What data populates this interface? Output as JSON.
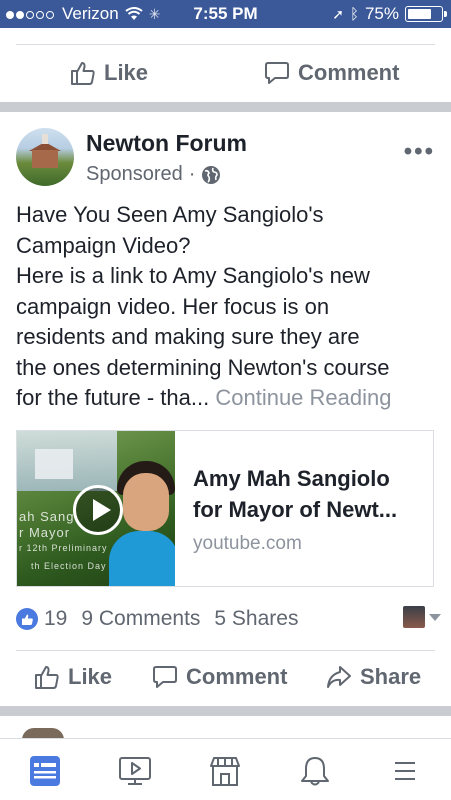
{
  "status_bar": {
    "carrier": "Verizon",
    "time": "7:55 PM",
    "battery": "75%",
    "battery_level": 0.75
  },
  "prev_post_actions": {
    "like": "Like",
    "comment": "Comment"
  },
  "post": {
    "page_name": "Newton Forum",
    "sponsored": "Sponsored",
    "sponsored_sep": "·",
    "more": "•••",
    "text_lines": [
      "Have You Seen Amy Sangiolo's",
      "Campaign Video?",
      "Here is a link to Amy Sangiolo's new",
      "campaign video.  Her focus is on",
      "residents and making sure they are",
      "the ones determining Newton's course",
      "for the future - tha..."
    ],
    "continue_reading": "Continue Reading",
    "link_card": {
      "title_line1": "Amy Mah Sangiolo",
      "title_line2": "for Mayor of Newt...",
      "domain": "youtube.com",
      "thumb_overlay": [
        "ah Sang",
        "r Mayor",
        "r 12th Preliminary",
        "th Election Day"
      ]
    },
    "reactions": {
      "likes": "19",
      "comments": "9 Comments",
      "shares": "5 Shares"
    },
    "actions": {
      "like": "Like",
      "comment": "Comment",
      "share": "Share"
    }
  },
  "bottom_nav": {
    "items": [
      "news-feed",
      "watch",
      "marketplace",
      "notifications",
      "menu"
    ],
    "active": "news-feed"
  },
  "colors": {
    "brand": "#3b5998",
    "active_nav": "#4a79e0",
    "text": "#1d2129",
    "secondary": "#606770",
    "separator": "#c9ccd1"
  }
}
